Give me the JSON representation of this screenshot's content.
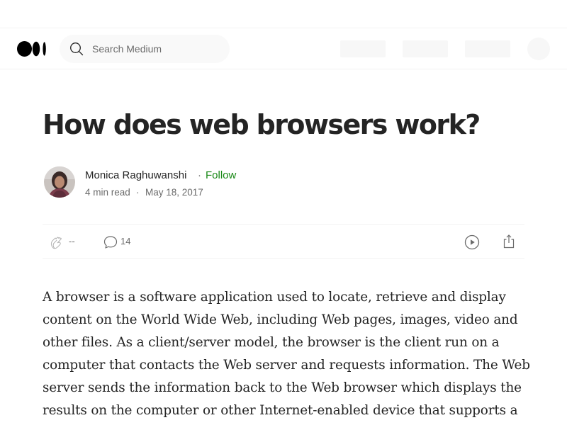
{
  "navbar": {
    "logo_name": "medium-logo",
    "search": {
      "placeholder": "Search Medium",
      "value": ""
    }
  },
  "article": {
    "title": "How does web browsers work?",
    "author": {
      "name": "Monica Raghuwanshi",
      "separator": "·",
      "follow_label": "Follow"
    },
    "meta": {
      "read_time": "4 min read",
      "separator": "·",
      "date": "May 18, 2017"
    },
    "actions": {
      "claps": "--",
      "responses": "14"
    },
    "body": "A browser is a software application used to locate, retrieve and display content on the World Wide Web, including Web pages, images, video and other files. As a client/server model, the browser is the client run on a computer that contacts the Web server and requests information. The Web server sends the information back to the Web browser which displays the results on the computer or other Internet-enabled device that supports a"
  },
  "colors": {
    "accent_follow": "#1a8917",
    "text_primary": "#242424",
    "text_secondary": "#6b6b6b"
  },
  "icons": [
    "medium-logo",
    "search-icon",
    "clap-icon",
    "response-icon",
    "play-icon",
    "share-icon"
  ]
}
